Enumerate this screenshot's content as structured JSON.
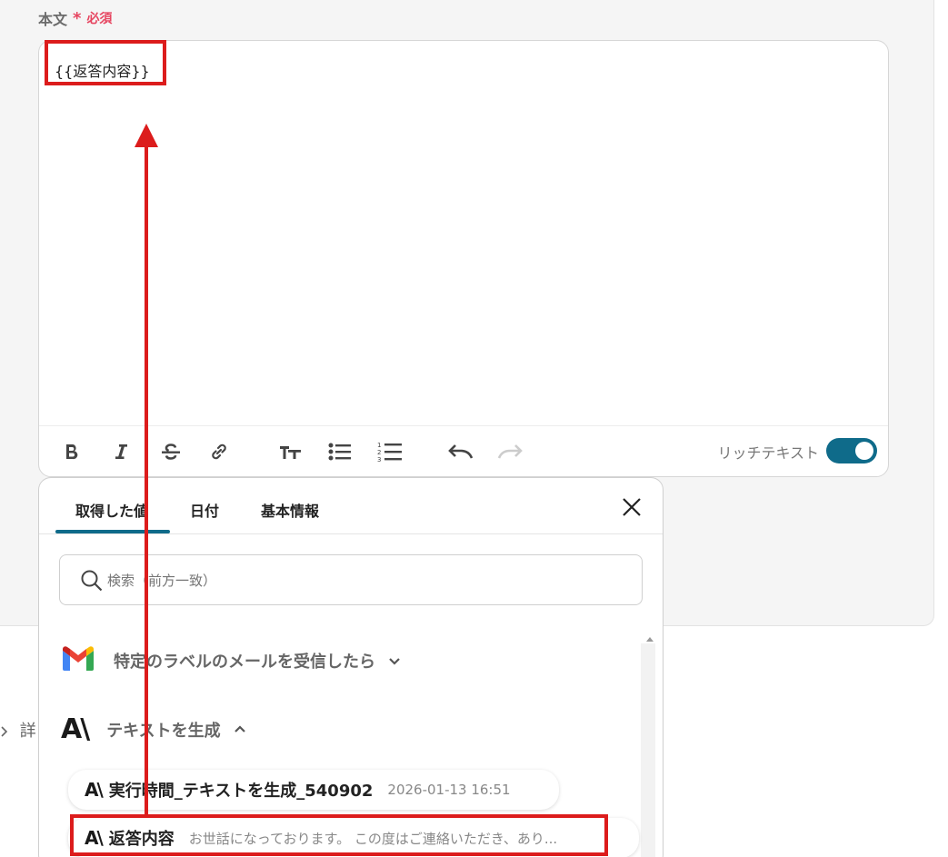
{
  "field": {
    "label": "本文",
    "required_star": "*",
    "required_label": "必須",
    "value": "{{返答内容}}"
  },
  "toolbar": {
    "icons": [
      "bold-icon",
      "italic-icon",
      "strikethrough-icon",
      "link-icon",
      "text-size-icon",
      "bulleted-list-icon",
      "numbered-list-icon",
      "undo-icon",
      "redo-icon"
    ],
    "rich_text_label": "リッチテキスト",
    "rich_text_enabled": true
  },
  "behind": {
    "text": "詳"
  },
  "popup": {
    "tabs": [
      {
        "label": "取得した値",
        "active": true
      },
      {
        "label": "日付",
        "active": false
      },
      {
        "label": "基本情報",
        "active": false
      }
    ],
    "search": {
      "placeholder": "検索（前方一致）"
    },
    "groups": [
      {
        "label": "特定のラベルのメールを受信したら",
        "icon": "gmail-icon",
        "expanded": false
      },
      {
        "label": "テキストを生成",
        "icon": "anthropic-icon",
        "icon_text": "A\\",
        "expanded": true
      }
    ],
    "items": [
      {
        "icon_text": "A\\",
        "name": "実行時間_テキストを生成_540902",
        "value": "2026-01-13 16:51"
      },
      {
        "icon_text": "A\\",
        "name": "返答内容",
        "value": "お世話になっております。 この度はご連絡いただき、あり..."
      }
    ]
  },
  "colors": {
    "accent": "#0f6b8a",
    "required": "#e64560",
    "annotation": "#dc1c1c"
  }
}
